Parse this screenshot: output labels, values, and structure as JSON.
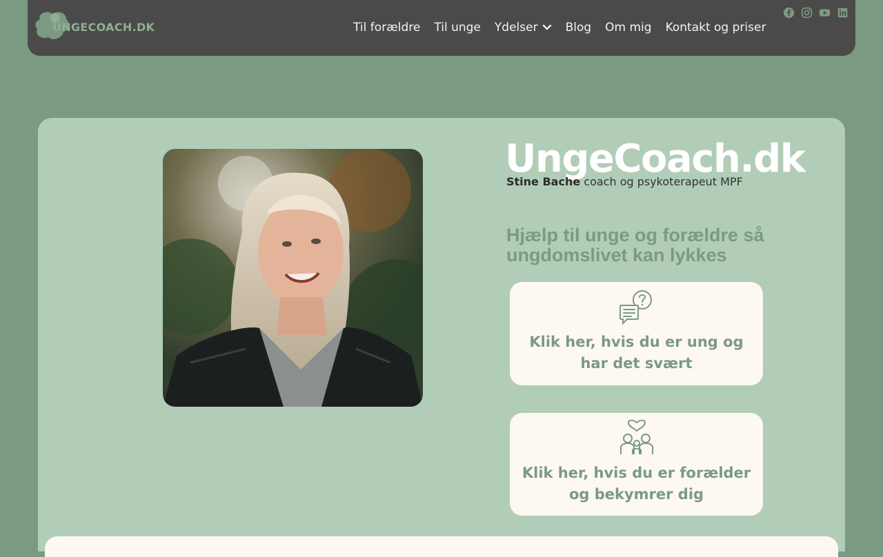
{
  "header": {
    "logo_text": "UNGECOACH.DK",
    "nav": [
      {
        "label": "Til forældre"
      },
      {
        "label": "Til unge"
      },
      {
        "label": "Ydelser",
        "has_dropdown": true
      },
      {
        "label": "Blog"
      },
      {
        "label": "Om mig"
      },
      {
        "label": "Kontakt og priser"
      }
    ],
    "social": [
      "facebook-icon",
      "instagram-icon",
      "youtube-icon",
      "linkedin-icon"
    ]
  },
  "hero": {
    "title": "UngeCoach.dk",
    "name": "Stine Bache",
    "role": " coach og psykoterapeut MPF",
    "tagline": "Hjælp til unge og forældre så ungdomslivet kan lykkes",
    "cta_young": "Klik her, hvis du er ung og har det svært",
    "cta_parent": "Klik her, hvis du er forælder og bekymrer dig"
  },
  "colors": {
    "page_bg": "#7a9a82",
    "header_bg": "#4a4a4a",
    "hero_bg": "#b1cdb7",
    "card_bg": "#fdf8f1",
    "accent": "#7a9a82"
  }
}
